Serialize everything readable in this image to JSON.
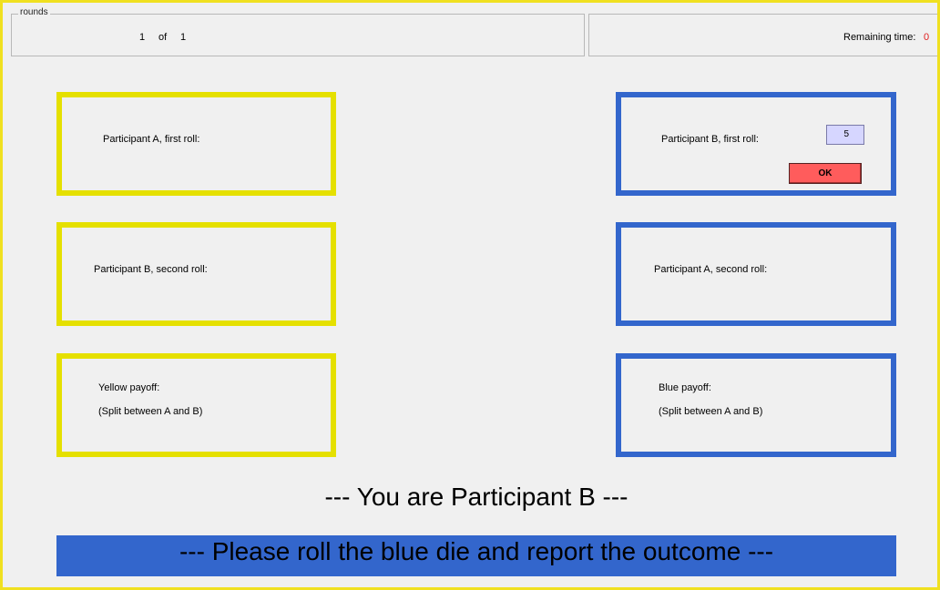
{
  "header": {
    "rounds_title": "rounds",
    "round_current": "1",
    "round_of": "of",
    "round_total": "1",
    "remaining_label": "Remaining time:",
    "remaining_value": "0"
  },
  "yellow_panel": {
    "first_roll_label": "Participant A, first roll:",
    "second_roll_label": "Participant B, second roll:",
    "payoff_label": "Yellow payoff:",
    "payoff_note": "(Split between A and B)"
  },
  "blue_panel": {
    "first_roll_label": "Participant B, first roll:",
    "first_roll_input": "5",
    "ok_label": "OK",
    "second_roll_label": "Participant A, second roll:",
    "payoff_label": "Blue payoff:",
    "payoff_note": "(Split between A and B)"
  },
  "role_message": "--- You are Participant B ---",
  "instruction_banner": "--- Please roll the blue die and report the outcome ---",
  "colors": {
    "yellow_border": "#e5e000",
    "blue_border": "#3366cc",
    "ok_button": "#ff5c5c",
    "remaining_value": "#e02020",
    "input_background": "#d6d6ff"
  }
}
